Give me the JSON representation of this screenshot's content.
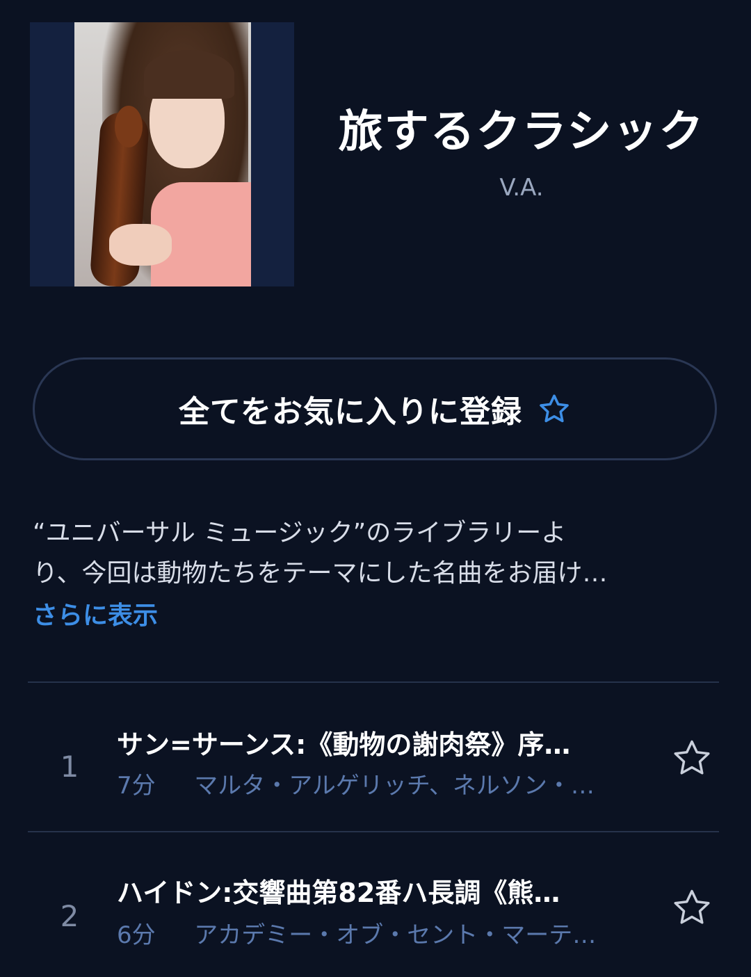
{
  "album": {
    "title": "旅するクラシック",
    "artist": "V.A.",
    "cover_icon": "album-cover-violinist-image"
  },
  "favorite_all": {
    "label": "全てをお気に入りに登録",
    "icon": "star-outline-icon",
    "icon_color": "#3d8ee6"
  },
  "description": {
    "lines": [
      "“ユニバーサル ミュージック”のライブラリーよ",
      "り、今回は動物たちをテーマにした名曲をお届け…"
    ],
    "more_label": "さらに表示",
    "more_color": "#3d8ee6"
  },
  "tracks": [
    {
      "number": "1",
      "title": "サン=サーンス:《動物の謝肉祭》序…",
      "duration": "7分",
      "artists": "マルタ・アルゲリッチ、ネルソン・…",
      "icon": "star-outline-icon"
    },
    {
      "number": "2",
      "title": "ハイドン:交響曲第82番ハ長調《熊…",
      "duration": "6分",
      "artists": "アカデミー・オブ・セント・マーテ…",
      "icon": "star-outline-icon"
    }
  ],
  "colors": {
    "background": "#0b1222",
    "accent": "#3d8ee6",
    "meta_text": "#5b79ad",
    "divider": "#26324b"
  }
}
